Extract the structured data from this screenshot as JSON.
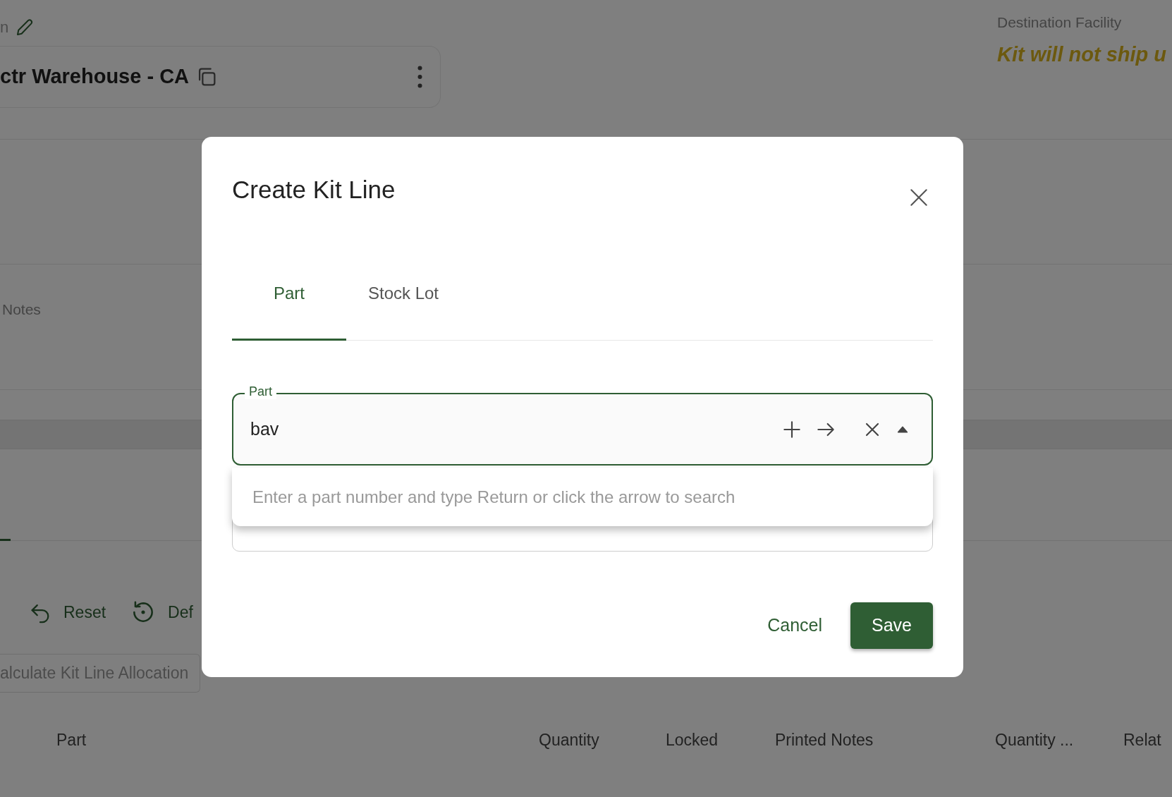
{
  "background": {
    "header_fragment": "n",
    "facility_card": {
      "title": "ctr Warehouse - CA"
    },
    "destination": {
      "label": "Destination Facility",
      "warning": "Kit will not ship u"
    },
    "notes_label": "Notes",
    "toolbar": [
      {
        "kind": "undo",
        "label": "Reset"
      },
      {
        "kind": "restore",
        "label": "Def"
      }
    ],
    "action_button": "alculate Kit Line Allocation",
    "table": {
      "columns": [
        "Part",
        "Quantity",
        "Locked",
        "Printed Notes",
        "Quantity ...",
        "Relat"
      ]
    }
  },
  "modal": {
    "title": "Create Kit Line",
    "tabs": [
      {
        "label": "Part",
        "selected": true
      },
      {
        "label": "Stock Lot",
        "selected": false
      }
    ],
    "part_field": {
      "label": "Part",
      "value": "bav"
    },
    "dropdown": {
      "hint": "Enter a part number and type Return or click the arrow to search"
    },
    "buttons": [
      {
        "kind": "text",
        "label": "Cancel"
      },
      {
        "kind": "primary",
        "label": "Save"
      }
    ]
  }
}
